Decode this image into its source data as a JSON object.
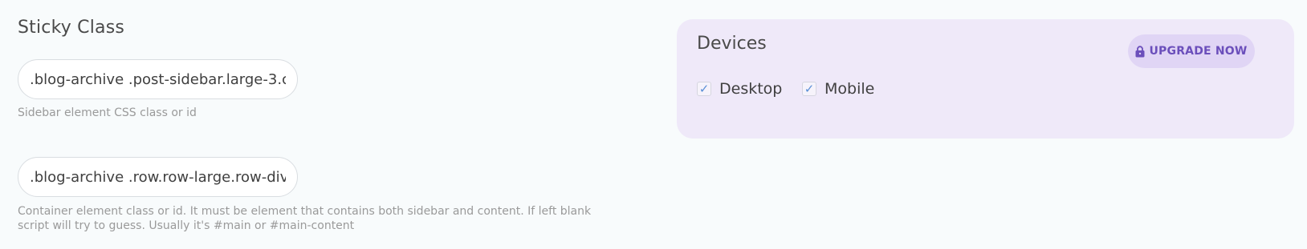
{
  "sticky_class": {
    "title": "Sticky Class",
    "sidebar_input": {
      "value": ".blog-archive .post-sidebar.large-3.c",
      "help": "Sidebar element CSS class or id"
    },
    "container_input": {
      "value": ".blog-archive .row.row-large.row-div",
      "help_line_1": "Container element class or id. It must be element that contains both sidebar and content. If left blank",
      "help_line_2": "script will try to guess. Usually it's #main or #main-content"
    }
  },
  "devices": {
    "title": "Devices",
    "upgrade_label": "UPGRADE NOW",
    "options": [
      {
        "label": "Desktop",
        "checked": true
      },
      {
        "label": "Mobile",
        "checked": true
      }
    ]
  },
  "colors": {
    "page_background": "#f8fbfc",
    "panel_background": "#efe9f9",
    "upgrade_background": "#e0d5f5",
    "upgrade_text": "#6b4fbb",
    "check_mark": "#5a8fd6"
  }
}
